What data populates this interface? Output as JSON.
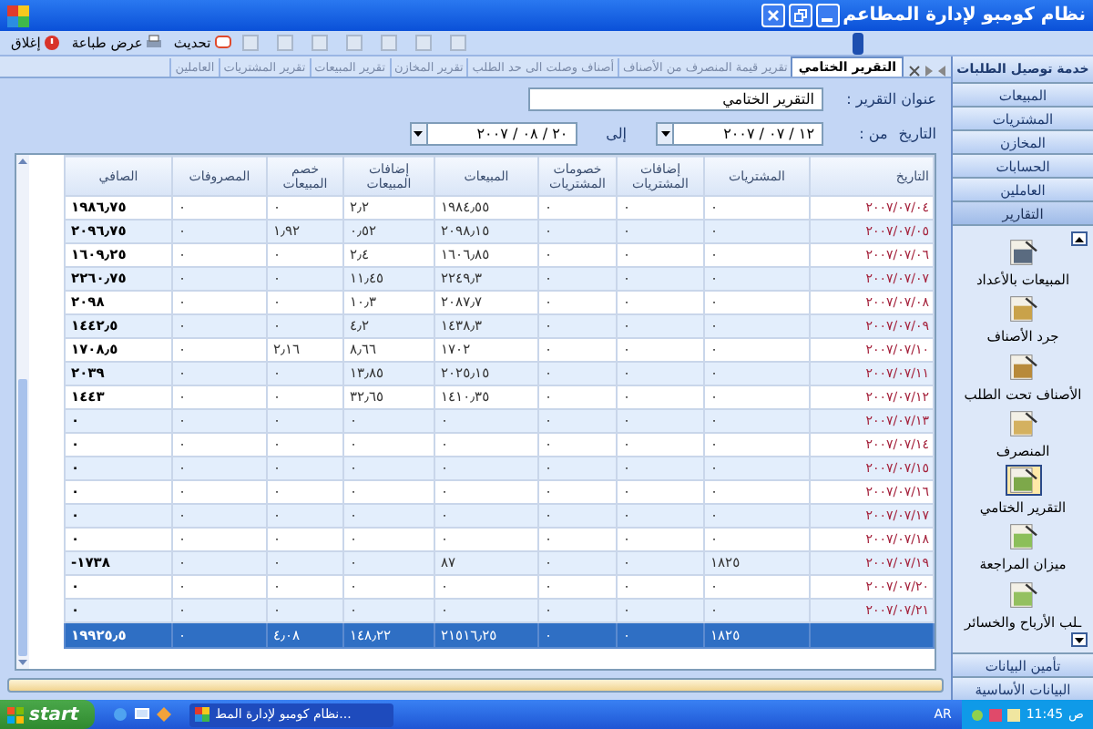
{
  "window": {
    "title": "نظام كومبو لإدارة المطاعم"
  },
  "toolbar": {
    "buttons": [
      {
        "label": "تحديث",
        "kind": "refresh"
      },
      {
        "label": "عرض طباعة",
        "kind": "print"
      },
      {
        "label": "إغلاق",
        "kind": "close"
      }
    ]
  },
  "tabs": [
    {
      "label": "التقرير الختامي",
      "selected": true
    },
    {
      "label": "تقرير قيمة المنصرف من الأصناف",
      "selected": false
    },
    {
      "label": "أصناف وصلت الى حد الطلب",
      "selected": false
    },
    {
      "label": "تقرير المخازن",
      "selected": false
    },
    {
      "label": "تقرير المبيعات",
      "selected": false
    },
    {
      "label": "تقرير المشتريات",
      "selected": false
    },
    {
      "label": "العاملين",
      "selected": false
    }
  ],
  "form": {
    "title_label": "عنوان التقرير :",
    "title_value": "التقرير الختامي",
    "date_label": "التاريخ",
    "from_label": "من :",
    "from_value": "١٢ / ٠٧ / ٢٠٠٧",
    "to_label": "إلى",
    "to_value": "٢٠ / ٠٨ / ٢٠٠٧"
  },
  "table": {
    "columns": [
      "التاريخ",
      "المشتريات",
      "إضافات المشتريات",
      "خصومات المشتريات",
      "المبيعات",
      "إضافات المبيعات",
      "خصم المبيعات",
      "المصروفات",
      "الصافي"
    ],
    "rows": [
      {
        "date": "٢٠٠٧/٠٧/٠٤",
        "values": [
          "٠",
          "٠",
          "٠",
          "١٩٨٤٫٥٥",
          "٢٫٢",
          "٠",
          "٠",
          "١٩٨٦٫٧٥"
        ]
      },
      {
        "date": "٢٠٠٧/٠٧/٠٥",
        "values": [
          "٠",
          "٠",
          "٠",
          "٢٠٩٨٫١٥",
          "٠٫٥٢",
          "١٫٩٢",
          "٠",
          "٢٠٩٦٫٧٥"
        ]
      },
      {
        "date": "٢٠٠٧/٠٧/٠٦",
        "values": [
          "٠",
          "٠",
          "٠",
          "١٦٠٦٫٨٥",
          "٢٫٤",
          "٠",
          "٠",
          "١٦٠٩٫٢٥"
        ]
      },
      {
        "date": "٢٠٠٧/٠٧/٠٧",
        "values": [
          "٠",
          "٠",
          "٠",
          "٢٢٤٩٫٣",
          "١١٫٤٥",
          "٠",
          "٠",
          "٢٢٦٠٫٧٥"
        ]
      },
      {
        "date": "٢٠٠٧/٠٧/٠٨",
        "values": [
          "٠",
          "٠",
          "٠",
          "٢٠٨٧٫٧",
          "١٠٫٣",
          "٠",
          "٠",
          "٢٠٩٨"
        ]
      },
      {
        "date": "٢٠٠٧/٠٧/٠٩",
        "values": [
          "٠",
          "٠",
          "٠",
          "١٤٣٨٫٣",
          "٤٫٢",
          "٠",
          "٠",
          "١٤٤٢٫٥"
        ]
      },
      {
        "date": "٢٠٠٧/٠٧/١٠",
        "values": [
          "٠",
          "٠",
          "٠",
          "١٧٠٢",
          "٨٫٦٦",
          "٢٫١٦",
          "٠",
          "١٧٠٨٫٥"
        ]
      },
      {
        "date": "٢٠٠٧/٠٧/١١",
        "values": [
          "٠",
          "٠",
          "٠",
          "٢٠٢٥٫١٥",
          "١٣٫٨٥",
          "٠",
          "٠",
          "٢٠٣٩"
        ]
      },
      {
        "date": "٢٠٠٧/٠٧/١٢",
        "values": [
          "٠",
          "٠",
          "٠",
          "١٤١٠٫٣٥",
          "٣٢٫٦٥",
          "٠",
          "٠",
          "١٤٤٣"
        ]
      },
      {
        "date": "٢٠٠٧/٠٧/١٣",
        "values": [
          "٠",
          "٠",
          "٠",
          "٠",
          "٠",
          "٠",
          "٠",
          "٠"
        ]
      },
      {
        "date": "٢٠٠٧/٠٧/١٤",
        "values": [
          "٠",
          "٠",
          "٠",
          "٠",
          "٠",
          "٠",
          "٠",
          "٠"
        ]
      },
      {
        "date": "٢٠٠٧/٠٧/١٥",
        "values": [
          "٠",
          "٠",
          "٠",
          "٠",
          "٠",
          "٠",
          "٠",
          "٠"
        ]
      },
      {
        "date": "٢٠٠٧/٠٧/١٦",
        "values": [
          "٠",
          "٠",
          "٠",
          "٠",
          "٠",
          "٠",
          "٠",
          "٠"
        ]
      },
      {
        "date": "٢٠٠٧/٠٧/١٧",
        "values": [
          "٠",
          "٠",
          "٠",
          "٠",
          "٠",
          "٠",
          "٠",
          "٠"
        ]
      },
      {
        "date": "٢٠٠٧/٠٧/١٨",
        "values": [
          "٠",
          "٠",
          "٠",
          "٠",
          "٠",
          "٠",
          "٠",
          "٠"
        ]
      },
      {
        "date": "٢٠٠٧/٠٧/١٩",
        "values": [
          "١٨٢٥",
          "٠",
          "٠",
          "٨٧",
          "٠",
          "٠",
          "٠",
          "١٧٣٨-"
        ]
      },
      {
        "date": "٢٠٠٧/٠٧/٢٠",
        "values": [
          "٠",
          "٠",
          "٠",
          "٠",
          "٠",
          "٠",
          "٠",
          "٠"
        ]
      },
      {
        "date": "٢٠٠٧/٠٧/٢١",
        "values": [
          "٠",
          "٠",
          "٠",
          "٠",
          "٠",
          "٠",
          "٠",
          "٠"
        ]
      }
    ],
    "totals": [
      "١٨٢٥",
      "٠",
      "٠",
      "٢١٥١٦٫٢٥",
      "١٤٨٫٢٢",
      "٤٫٠٨",
      "٠",
      "١٩٩٢٥٫٥"
    ]
  },
  "sidebar": {
    "header": "خدمة توصيل الطلبات",
    "sections": [
      {
        "label": "المبيعات",
        "selected": false
      },
      {
        "label": "المشتريات",
        "selected": false
      },
      {
        "label": "المخازن",
        "selected": false
      },
      {
        "label": "الحسابات",
        "selected": false
      },
      {
        "label": "العاملين",
        "selected": false
      },
      {
        "label": "التقارير",
        "selected": true
      }
    ],
    "items": [
      {
        "label": "المبيعات بالأعداد",
        "selected": false
      },
      {
        "label": "جرد الأصناف",
        "selected": false
      },
      {
        "label": "الأصناف تحت الطلب",
        "selected": false
      },
      {
        "label": "المنصرف",
        "selected": false
      },
      {
        "label": "التقرير الختامي",
        "selected": true
      },
      {
        "label": "ميزان المراجعة",
        "selected": false
      },
      {
        "label": "ـلب الأرباح والخسائر",
        "selected": false
      }
    ],
    "bottom_sections": [
      {
        "label": "تأمين البيانات"
      },
      {
        "label": "البيانات الأساسية"
      }
    ]
  },
  "taskbar": {
    "start": "start",
    "task": "...نظام كومبو لإدارة المط",
    "language": "AR",
    "time": "11:45",
    "ampm": "ص"
  }
}
